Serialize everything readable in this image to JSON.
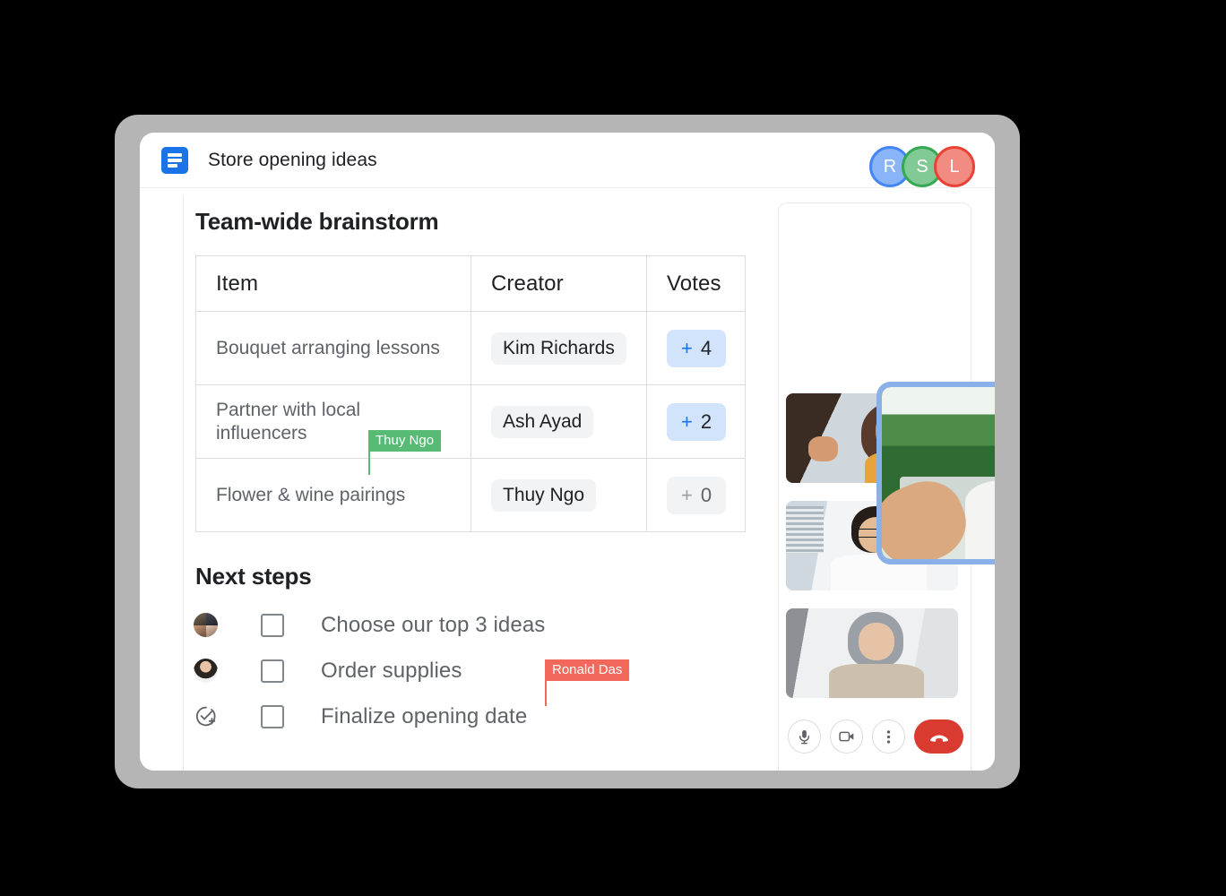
{
  "document": {
    "icon": "docs-icon",
    "title": "Store opening ideas",
    "sections": {
      "brainstorm_title": "Team-wide brainstorm",
      "next_steps_title": "Next steps"
    }
  },
  "presence_avatars": [
    {
      "initial": "R",
      "ring_color": "#4285f4",
      "fill_color": "#8ab4f8"
    },
    {
      "initial": "S",
      "ring_color": "#34a853",
      "fill_color": "#81c995"
    },
    {
      "initial": "L",
      "ring_color": "#ea4335",
      "fill_color": "#f28b82"
    }
  ],
  "table": {
    "headers": [
      "Item",
      "Creator",
      "Votes"
    ],
    "rows": [
      {
        "item": "Bouquet arranging lessons",
        "creator": "Kim Richards",
        "votes_plus": "+",
        "votes": "4",
        "votes_state": "active"
      },
      {
        "item": "Partner with local influencers",
        "creator": "Ash Ayad",
        "votes_plus": "+",
        "votes": "2",
        "votes_state": "active"
      },
      {
        "item": "Flower & wine pairings",
        "creator": "Thuy Ngo",
        "votes_plus": "+",
        "votes": "0",
        "votes_state": "zero"
      }
    ]
  },
  "cursors": [
    {
      "name": "Thuy Ngo",
      "color": "#57bb76"
    },
    {
      "name": "Ronald Das",
      "color": "#f2685c"
    }
  ],
  "next_steps": [
    {
      "label": "Choose our top 3 ideas",
      "avatar": "group-avatar",
      "checked": false
    },
    {
      "label": "Order supplies",
      "avatar": "single-avatar",
      "checked": false
    },
    {
      "label": "Finalize opening date",
      "avatar": "assign-task-icon",
      "checked": false
    }
  ],
  "video_call": {
    "main_participant": "main-speaker-video",
    "speaking_badge": "speaking-indicator-icon",
    "main_border_color": "#8ab0e8",
    "tiles": [
      "participant-video-1",
      "participant-video-2",
      "participant-video-3"
    ],
    "controls": [
      {
        "name": "microphone-button",
        "icon": "microphone-icon",
        "style": "normal"
      },
      {
        "name": "camera-button",
        "icon": "video-camera-icon",
        "style": "normal"
      },
      {
        "name": "more-options-button",
        "icon": "more-vert-icon",
        "style": "normal"
      },
      {
        "name": "end-call-button",
        "icon": "phone-hangup-icon",
        "style": "danger",
        "color": "#d93b30"
      }
    ]
  }
}
